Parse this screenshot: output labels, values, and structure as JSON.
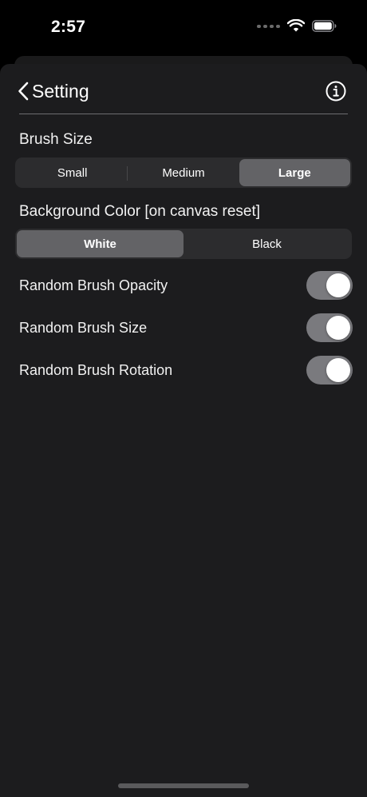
{
  "status_bar": {
    "time": "2:57"
  },
  "nav": {
    "back_label": "Setting"
  },
  "brush_size": {
    "label": "Brush Size",
    "options": [
      "Small",
      "Medium",
      "Large"
    ],
    "selected": "Large"
  },
  "background_color": {
    "label": "Background Color [on canvas reset]",
    "options": [
      "White",
      "Black"
    ],
    "selected": "White"
  },
  "toggles": [
    {
      "label": "Random Brush Opacity",
      "on": true
    },
    {
      "label": "Random Brush Size",
      "on": true
    },
    {
      "label": "Random Brush Rotation",
      "on": true
    }
  ],
  "colors": {
    "sheet_background": "#1c1c1e",
    "segment_selected": "#636366",
    "switch_on": "#7a7a7e"
  }
}
